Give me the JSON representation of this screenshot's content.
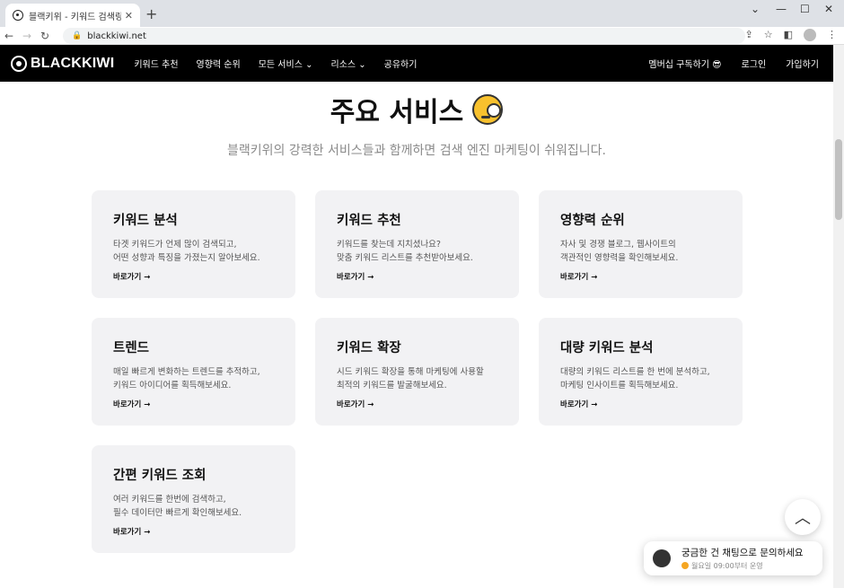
{
  "browser": {
    "tab_title": "블랙키위 - 키워드 검색량 조회",
    "tab_close": "✕",
    "new_tab": "+",
    "url": "blackkiwi.net",
    "window_controls": [
      "⌄",
      "—",
      "☐",
      "✕"
    ]
  },
  "nav": {
    "logo": "BLACKKIWI",
    "menu": [
      "키워드 추천",
      "영향력 순위",
      "모든 서비스 ⌄",
      "리소스 ⌄",
      "공유하기"
    ],
    "right": [
      "멤버십 구독하기 😎",
      "로그인",
      "가입하기"
    ]
  },
  "main": {
    "title": "주요 서비스",
    "subtitle": "블랙키위의 강력한 서비스들과 함께하면 검색 엔진 마케팅이 쉬워집니다.",
    "go_label": "바로가기 →",
    "cards": [
      {
        "title": "키워드 분석",
        "desc": "타겟 키워드가 언제 많이 검색되고,\n어떤 성향과 특징을 가졌는지 알아보세요."
      },
      {
        "title": "키워드 추천",
        "desc": "키워드를 찾는데 지치셨나요?\n맞춤 키워드 리스트를 추천받아보세요."
      },
      {
        "title": "영향력 순위",
        "desc": "자사 및 경쟁 블로그, 웹사이트의\n객관적인 영향력을 확인해보세요."
      },
      {
        "title": "트렌드",
        "desc": "매일 빠르게 변화하는 트렌드를 추적하고,\n키워드 아이디어를 획득해보세요."
      },
      {
        "title": "키워드 확장",
        "desc": "시드 키워드 확장을 통해 마케팅에 사용할\n최적의 키워드를 발굴해보세요."
      },
      {
        "title": "대량 키워드 분석",
        "desc": "대량의 키워드 리스트를 한 번에 분석하고,\n마케팅 인사이트를 획득해보세요."
      },
      {
        "title": "간편 키워드 조회",
        "desc": "여러 키워드를 한번에 검색하고,\n필수 데이터만 빠르게 확인해보세요."
      }
    ]
  },
  "chat": {
    "title": "궁금한 건 채팅으로 문의하세요",
    "hours": "월요일 09:00부터 운영"
  },
  "icons": {
    "scroll_top": "chevron-up-icon",
    "chat": "chat-bubble-icon"
  }
}
